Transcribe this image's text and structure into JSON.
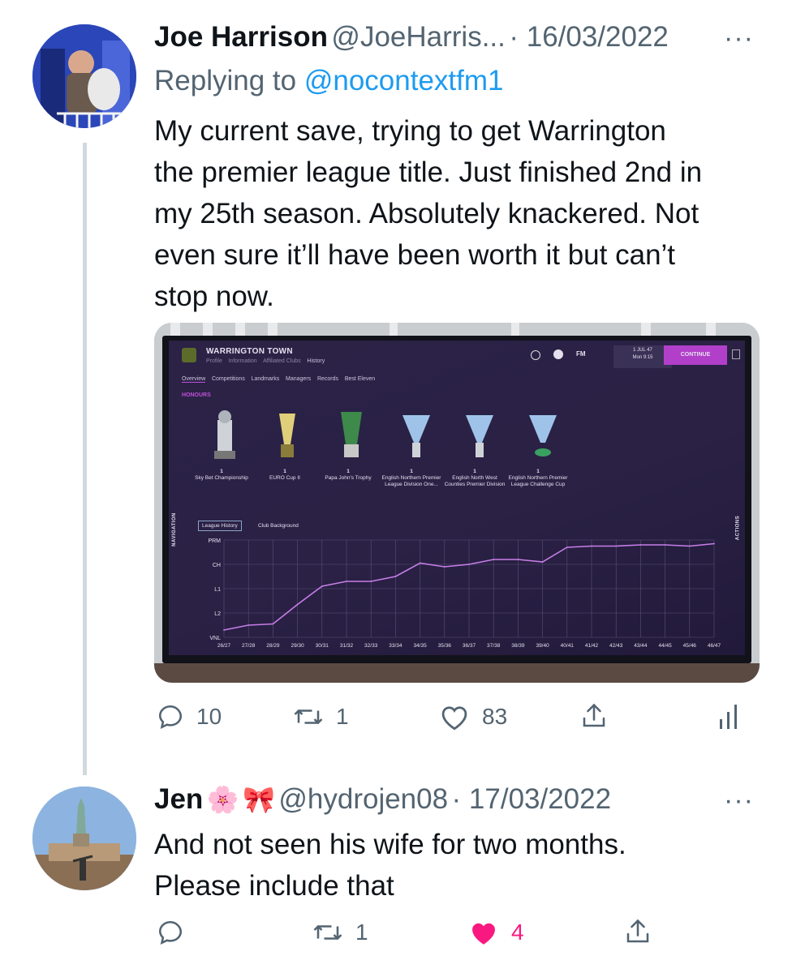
{
  "tweet1": {
    "name": "Joe Harrison",
    "handle": "@JoeHarris...",
    "date": "· 16/03/2022",
    "more": "···",
    "replying_prefix": "Replying to ",
    "replying_handle": "@nocontextfm1",
    "text_lines": [
      "My current save, trying to get Warrington",
      "the premier league title. Just finished 2nd in",
      "my 25th season. Absolutely knackered. Not",
      "even sure it’ll have been worth it but can’t",
      "stop now."
    ],
    "stats": {
      "replies": "10",
      "retweets": "1",
      "likes": "83"
    }
  },
  "tweet2": {
    "name": "Jen",
    "emoji1": "🌸",
    "emoji2": "🎀",
    "handle": "@hydrojen08",
    "date": "· 17/03/2022",
    "more": "···",
    "text_lines": [
      "And not seen his wife for two months.",
      "Please include that"
    ],
    "stats": {
      "replies": "",
      "retweets": "1",
      "likes": "4"
    },
    "liked_color": "#f91880"
  },
  "fm": {
    "club": "WARRINGTON TOWN",
    "subnav": [
      "Profile",
      "Information",
      "Affiliated Clubs",
      "History"
    ],
    "tabs": [
      "Overview",
      "Competitions",
      "Landmarks",
      "Managers",
      "Records",
      "Best Eleven"
    ],
    "date_line1": "1 JUL 47",
    "date_line2": "Mon 9:15",
    "continue_label": "CONTINUE",
    "fm_logo": "FM",
    "honours_label": "HONOURS",
    "navigation_label": "NAVIGATION",
    "actions_label": "ACTIONS",
    "honours": [
      {
        "count": "1",
        "name": "Sky Bet Championship"
      },
      {
        "count": "1",
        "name": "EURO Cup II"
      },
      {
        "count": "1",
        "name": "Papa John's Trophy"
      },
      {
        "count": "1",
        "name": "English Northern Premier League Division One..."
      },
      {
        "count": "1",
        "name": "English North West Counties Premier Division"
      },
      {
        "count": "1",
        "name": "English Northern Premier League Challenge Cup"
      }
    ],
    "history_tabs": [
      "League History",
      "Club Background"
    ],
    "accent": "#c04fd8"
  },
  "chart_data": {
    "type": "line",
    "title": "",
    "xlabel": "",
    "ylabel": "",
    "y_levels": [
      "PRM",
      "CH",
      "L1",
      "L2",
      "VNL"
    ],
    "x": [
      "26/27",
      "27/28",
      "28/29",
      "29/30",
      "30/31",
      "31/32",
      "32/33",
      "33/34",
      "34/35",
      "35/36",
      "36/37",
      "37/38",
      "38/39",
      "39/40",
      "40/41",
      "41/42",
      "42/43",
      "43/44",
      "44/45",
      "45/46",
      "46/47"
    ],
    "series": [
      {
        "name": "",
        "values": [
          1.3,
          1.5,
          1.55,
          2.35,
          3.1,
          3.3,
          3.3,
          3.5,
          4.05,
          3.9,
          4.0,
          4.2,
          4.2,
          4.1,
          4.7,
          4.75,
          4.75,
          4.8,
          4.8,
          4.75,
          4.85
        ]
      }
    ],
    "ylim": [
      1,
      5
    ],
    "grid": true,
    "line_color": "#c77ee8"
  }
}
